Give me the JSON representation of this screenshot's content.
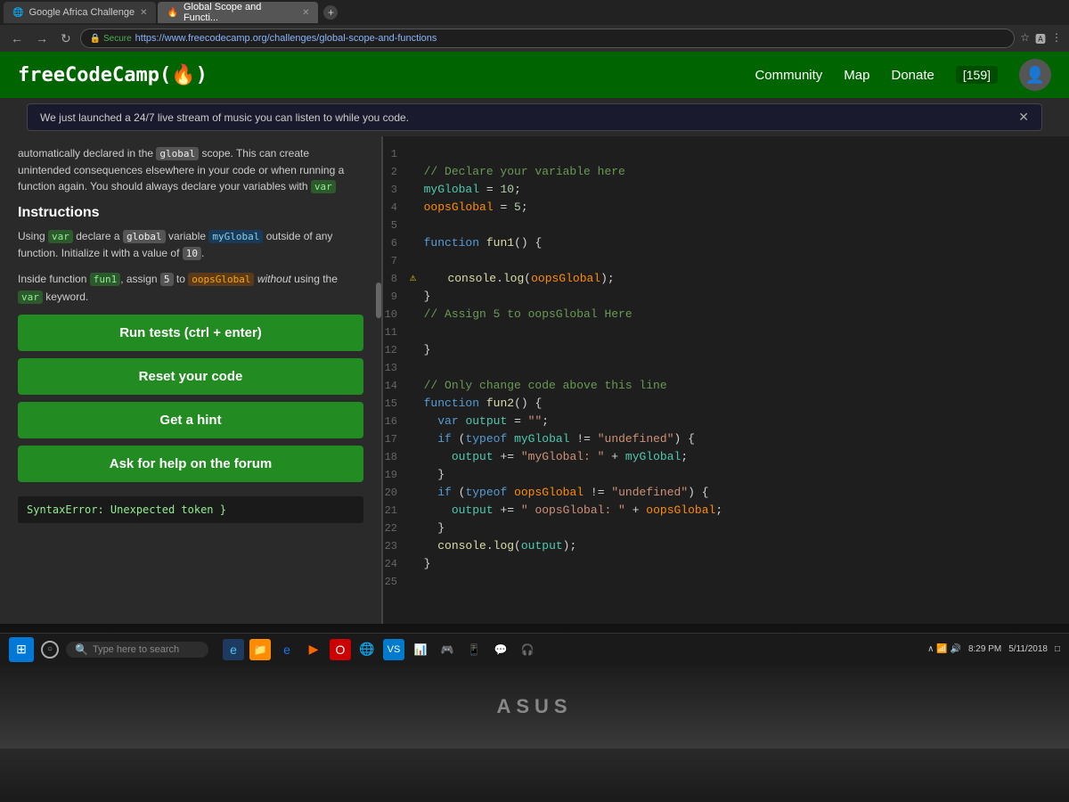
{
  "browser": {
    "tabs": [
      {
        "id": "tab1",
        "label": "Google Africa Challenge",
        "active": false,
        "icon": "🌐"
      },
      {
        "id": "tab2",
        "label": "Global Scope and Functi...",
        "active": true,
        "icon": "🔥"
      }
    ],
    "url": "https://www.freecodecamp.org/challenges/global-scope-and-functions",
    "secure": true
  },
  "header": {
    "logo": "freeCodeCamp(🔥)",
    "nav": {
      "community": "Community",
      "map": "Map",
      "donate": "Donate",
      "points": "[159]"
    }
  },
  "notification": {
    "text": "We just launched a 24/7 live stream of music you can listen to while you code."
  },
  "left_panel": {
    "description": "automatically declared in the global scope. This can create unintended consequences elsewhere in your code or when running a function again. You should always declare your variables with var",
    "instructions_title": "Instructions",
    "instruction1": "Using var declare a global variable myGlobal outside of any function. Initialize it with a value of 10.",
    "instruction2": "Inside function fun1, assign 5 to oopsGlobal without using the var keyword.",
    "buttons": {
      "run_tests": "Run tests (ctrl + enter)",
      "reset": "Reset your code",
      "hint": "Get a hint",
      "forum": "Ask for help on the forum"
    },
    "error": "SyntaxError: Unexpected token }"
  },
  "code_editor": {
    "lines": [
      {
        "num": 1,
        "content": ""
      },
      {
        "num": 2,
        "content": "  // Declare your variable here"
      },
      {
        "num": 3,
        "content": "  myGlobal = 10;"
      },
      {
        "num": 4,
        "content": "  oopsGlobal = 5;"
      },
      {
        "num": 5,
        "content": ""
      },
      {
        "num": 6,
        "content": "  function fun1() {"
      },
      {
        "num": 7,
        "content": ""
      },
      {
        "num": 8,
        "content": "    console.log(oopsGlobal);",
        "warning": true
      },
      {
        "num": 9,
        "content": "  }"
      },
      {
        "num": 10,
        "content": "  // Assign 5 to oopsGlobal Here"
      },
      {
        "num": 11,
        "content": ""
      },
      {
        "num": 12,
        "content": "  }"
      },
      {
        "num": 13,
        "content": ""
      },
      {
        "num": 14,
        "content": "  // Only change code above this line"
      },
      {
        "num": 15,
        "content": "  function fun2() {"
      },
      {
        "num": 16,
        "content": "    var output = \"\";"
      },
      {
        "num": 17,
        "content": "    if (typeof myGlobal != \"undefined\") {"
      },
      {
        "num": 18,
        "content": "      output += \"myGlobal: \" + myGlobal;"
      },
      {
        "num": 19,
        "content": "    }"
      },
      {
        "num": 20,
        "content": "    if (typeof oopsGlobal != \"undefined\") {"
      },
      {
        "num": 21,
        "content": "      output += \" oopsGlobal: \" + oopsGlobal;"
      },
      {
        "num": 22,
        "content": "    }"
      },
      {
        "num": 23,
        "content": "    console.log(output);"
      },
      {
        "num": 24,
        "content": "  }"
      },
      {
        "num": 25,
        "content": ""
      }
    ]
  },
  "taskbar": {
    "search_placeholder": "Type here to search",
    "time": "8:29 PM",
    "date": "5/11/2018"
  },
  "laptop_brand": "ASUS"
}
